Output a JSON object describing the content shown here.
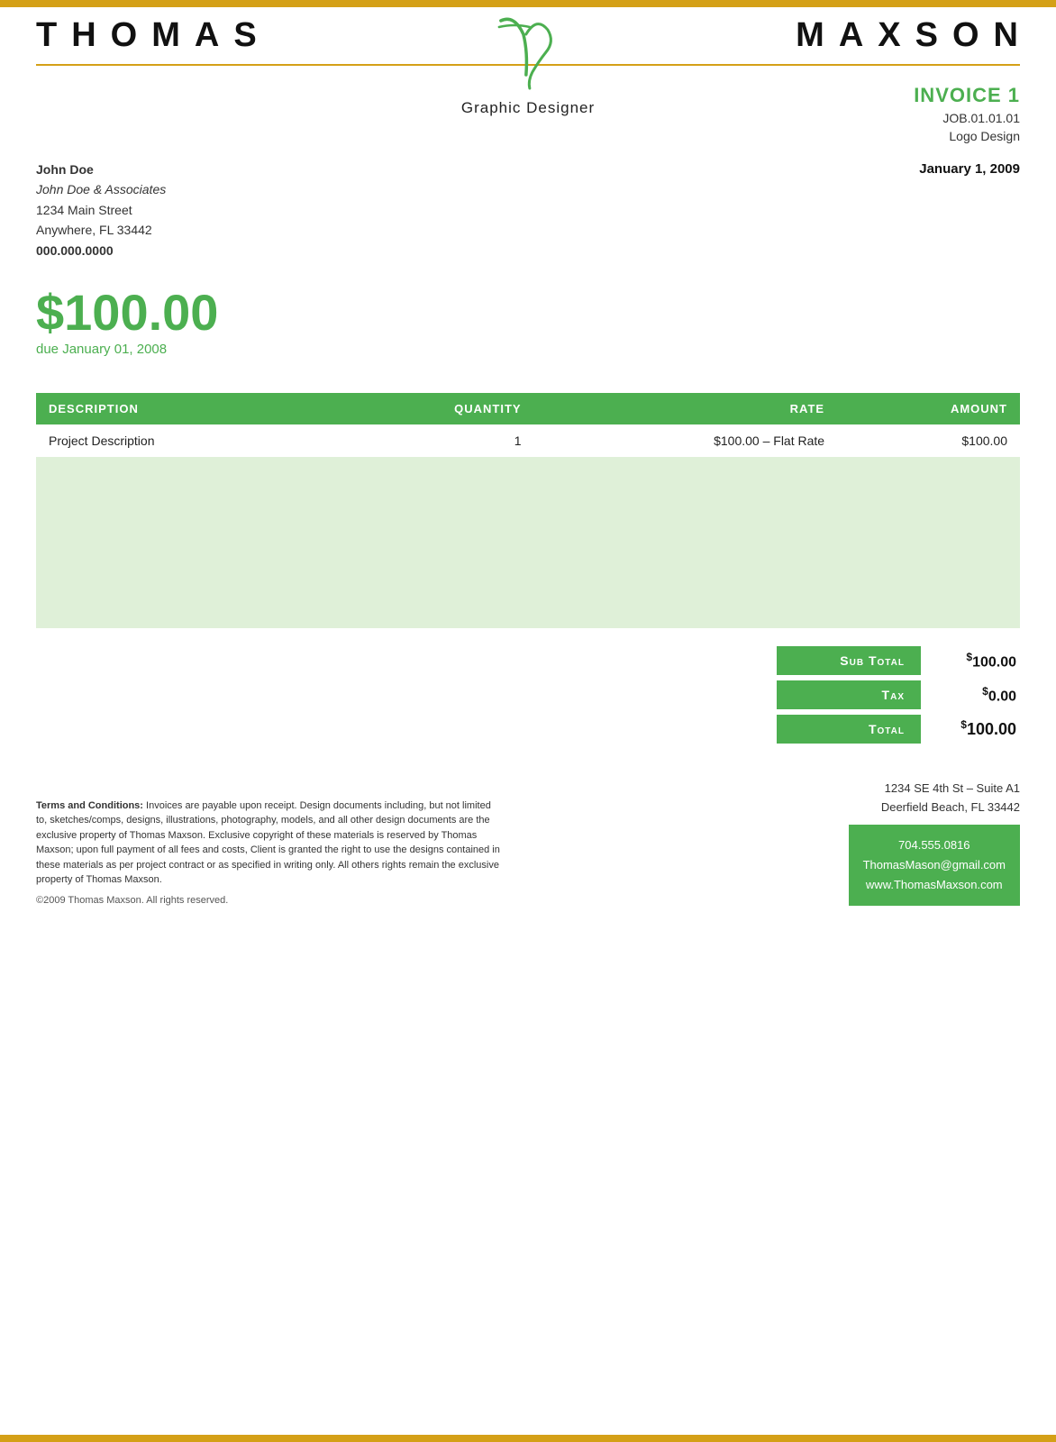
{
  "brand": {
    "name_left": [
      "T",
      "H",
      "O",
      "M",
      "A",
      "S"
    ],
    "name_right": [
      "M",
      "A",
      "X",
      "S",
      "O",
      "N"
    ],
    "subtitle": "Graphic Designer"
  },
  "invoice": {
    "label": "INVOICE 1",
    "job_number": "JOB.01.01.01",
    "job_name": "Logo Design",
    "date": "January 1, 2009"
  },
  "client": {
    "name": "John Doe",
    "company": "John Doe & Associates",
    "address_line1": "1234 Main Street",
    "address_line2": "Anywhere, FL 33442",
    "phone": "000.000.0000"
  },
  "amount_due": {
    "symbol": "$",
    "value": "100.00",
    "due_label": "due January 01, 2008"
  },
  "table": {
    "headers": {
      "description": "Description",
      "quantity": "Quantity",
      "rate": "Rate",
      "amount": "Amount"
    },
    "rows": [
      {
        "description": "Project Description",
        "quantity": "1",
        "rate": "$100.00 – Flat Rate",
        "amount": "$100.00",
        "type": "data"
      },
      {
        "type": "empty"
      },
      {
        "type": "empty"
      },
      {
        "type": "empty"
      },
      {
        "type": "empty"
      },
      {
        "type": "empty"
      }
    ]
  },
  "totals": {
    "sub_total_label": "Sub Total",
    "sub_total_value": "$100.00",
    "tax_label": "Tax",
    "tax_value": "$0.00",
    "total_label": "Total",
    "total_value": "$100.00"
  },
  "footer": {
    "address": "1234 SE 4th St – Suite A1\nDeerfield Beach, FL 33442",
    "phone": "704.555.0816",
    "email": "ThomasMason@gmail.com",
    "website": "www.ThomasMaxson.com",
    "terms_label": "Terms and Conditions:",
    "terms_text": "Invoices are payable upon receipt. Design documents including, but not limited to, sketches/comps, designs, illustrations, photography, models, and all other design documents are the exclusive property of Thomas Maxson. Exclusive copyright of these materials is reserved by Thomas Maxson; upon full payment of all fees and costs, Client is granted the right to use the designs contained in these materials as per project contract or as specified in writing only. All others rights remain the exclusive property of Thomas Maxson.",
    "copyright": "©2009 Thomas Maxson. All rights reserved."
  },
  "colors": {
    "green": "#4caf50",
    "gold": "#d4a017",
    "text_dark": "#111",
    "text_gray": "#333"
  }
}
